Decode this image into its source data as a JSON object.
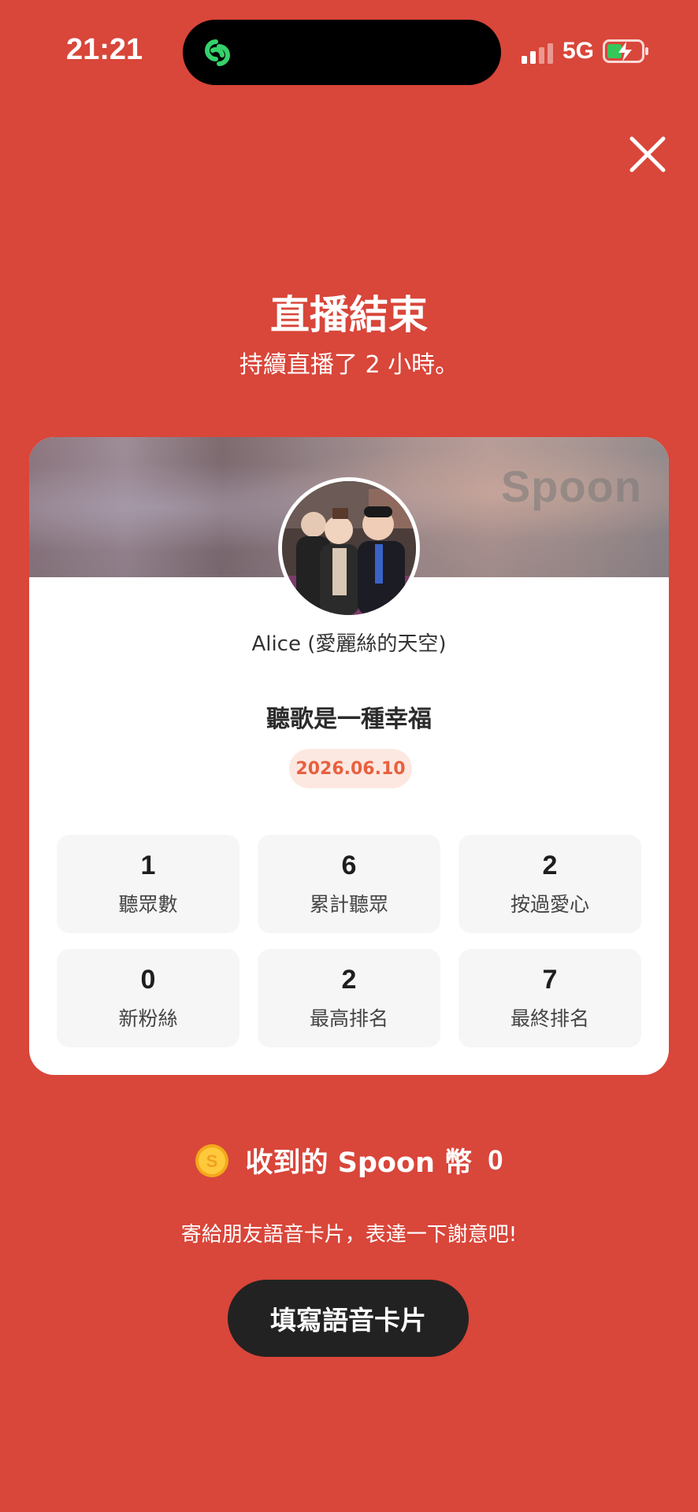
{
  "status_bar": {
    "time": "21:21",
    "network": "5G",
    "island_icon": "link-icon",
    "colors": {
      "island_icon": "#35d26b"
    }
  },
  "header": {
    "title": "直播結束",
    "subtitle": "持續直播了 2 小時。"
  },
  "card": {
    "brand": "Spoon",
    "username": "Alice (愛麗絲的天空)",
    "live_title": "聽歌是一種幸福",
    "date": "2026.06.10",
    "stats": [
      {
        "value": "1",
        "label": "聽眾數"
      },
      {
        "value": "6",
        "label": "累計聽眾"
      },
      {
        "value": "2",
        "label": "按過愛心"
      },
      {
        "value": "0",
        "label": "新粉絲"
      },
      {
        "value": "2",
        "label": "最高排名"
      },
      {
        "value": "7",
        "label": "最終排名"
      }
    ]
  },
  "coins": {
    "label": "收到的 Spoon 幣",
    "value": "0"
  },
  "footer": {
    "prompt": "寄給朋友語音卡片，表達一下謝意吧!",
    "cta_label": "填寫語音卡片"
  },
  "colors": {
    "background": "#d9463a",
    "accent": "#e8603f",
    "button": "#222222"
  }
}
